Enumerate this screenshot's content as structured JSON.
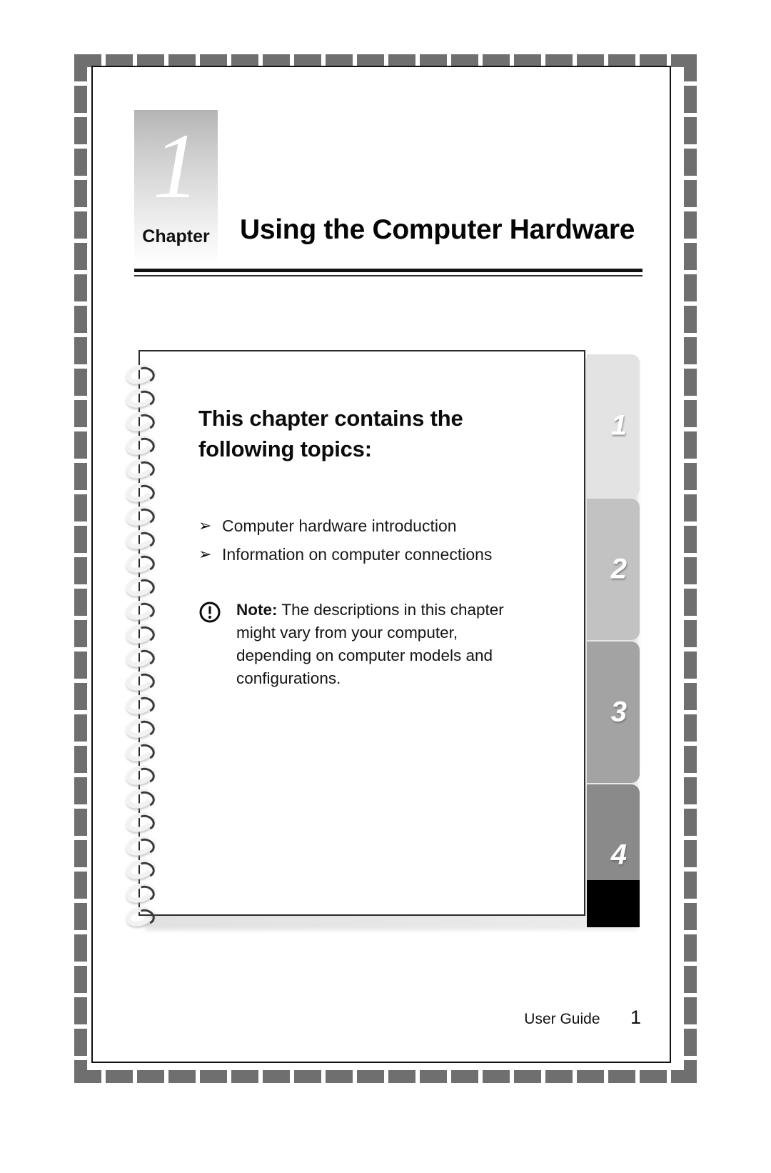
{
  "document": {
    "chapter_number": "1",
    "chapter_word": "Chapter",
    "chapter_title": "Using the Computer Hardware"
  },
  "notebook": {
    "heading": "This chapter contains the following topics:",
    "bullet_marker": "➢",
    "topics": [
      {
        "label": "Computer hardware introduction"
      },
      {
        "label": "Information on computer connections"
      }
    ],
    "note": {
      "icon": "exclamation-circle-icon",
      "label": "Note:",
      "text": " The descriptions in this chapter might vary from your computer, depending on computer models and configurations."
    }
  },
  "tabs": [
    {
      "number": "1",
      "color": "#e3e3e3"
    },
    {
      "number": "2",
      "color": "#c2c2c2"
    },
    {
      "number": "3",
      "color": "#a3a3a3"
    },
    {
      "number": "4",
      "color": "#8a8a8a"
    }
  ],
  "footer": {
    "guide_label": "User Guide",
    "page_number": "1"
  },
  "colors": {
    "frame_dash": "#6f6f6f",
    "page_border": "#111111",
    "text": "#111111",
    "sheet_border": "#2b2b2b",
    "tab_foot_black": "#000000"
  }
}
